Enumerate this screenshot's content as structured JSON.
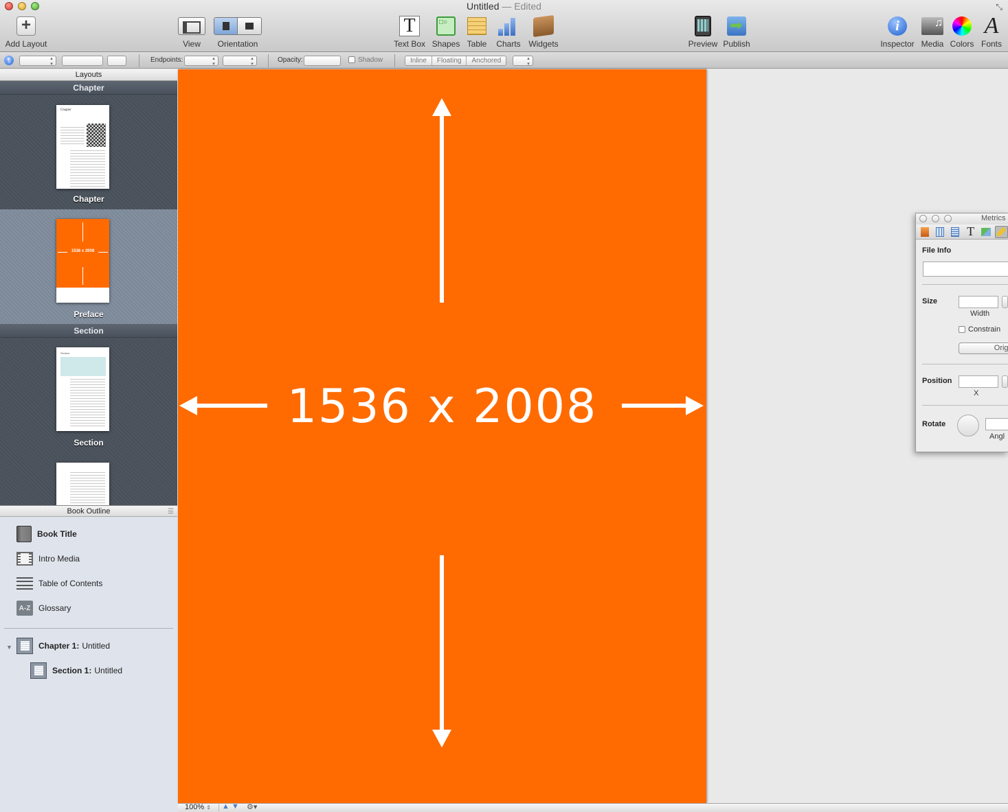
{
  "window": {
    "title": "Untitled",
    "title_separator": " — ",
    "title_status": "Edited"
  },
  "toolbar": {
    "add_layout": "Add Layout",
    "view": "View",
    "orientation": "Orientation",
    "text_box": "Text Box",
    "shapes": "Shapes",
    "table": "Table",
    "charts": "Charts",
    "widgets": "Widgets",
    "preview": "Preview",
    "publish": "Publish",
    "inspector": "Inspector",
    "media": "Media",
    "colors": "Colors",
    "fonts": "Fonts"
  },
  "format_bar": {
    "endpoints_label": "Endpoints:",
    "opacity_label": "Opacity:",
    "shadow_label": "Shadow",
    "wrap_modes": [
      "Inline",
      "Floating",
      "Anchored"
    ]
  },
  "layouts": {
    "header": "Layouts",
    "groups": [
      {
        "heading": "Chapter",
        "items": [
          {
            "label": "Chapter",
            "mini_title": "Chapter"
          },
          {
            "label": "Preface",
            "mini_text": "1536 x 2008"
          }
        ]
      },
      {
        "heading": "Section",
        "items": [
          {
            "label": "Section",
            "mini_title": "Section"
          }
        ]
      }
    ]
  },
  "outline": {
    "header": "Book Outline",
    "items": [
      {
        "label": "Book Title",
        "icon": "book-icon"
      },
      {
        "label": "Intro Media",
        "icon": "film-icon"
      },
      {
        "label": "Table of Contents",
        "icon": "list-icon"
      },
      {
        "label": "Glossary",
        "icon": "glossary-az-icon"
      }
    ],
    "chapters": [
      {
        "prefix": "Chapter 1:",
        "title": "Untitled"
      },
      {
        "prefix": "Section 1:",
        "title": "Untitled"
      }
    ]
  },
  "canvas": {
    "page_color": "#ff6b00",
    "dimension_text": "1536 x 2008"
  },
  "status_bar": {
    "zoom": "100%"
  },
  "metrics_inspector": {
    "title": "Metrics",
    "file_info_label": "File Info",
    "size_label": "Size",
    "width_label": "Width",
    "constrain_label": "Constrain",
    "original_button": "Origi",
    "position_label": "Position",
    "x_label": "X",
    "rotate_label": "Rotate",
    "angle_label": "Angl"
  },
  "colors": {
    "accent_orange": "#ff6b00",
    "sidebar_dark": "#4a525c",
    "outline_bg": "#dfe4ec"
  }
}
